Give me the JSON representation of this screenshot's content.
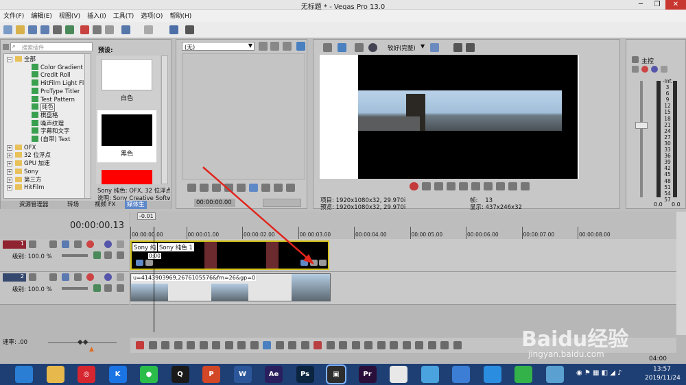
{
  "window": {
    "title": "无标题 * - Vegas Pro 13.0"
  },
  "menu": [
    "文件(F)",
    "编辑(E)",
    "视图(V)",
    "插入(I)",
    "工具(T)",
    "选项(O)",
    "帮助(H)"
  ],
  "explorer": {
    "search_placeholder": "搜索插件",
    "tree": [
      {
        "label": "全部",
        "kind": "folder",
        "expanded": true
      },
      {
        "label": "Color Gradient",
        "kind": "item"
      },
      {
        "label": "Credit Roll",
        "kind": "item"
      },
      {
        "label": "HitFilm Light Fla",
        "kind": "item"
      },
      {
        "label": "ProType Titler",
        "kind": "item"
      },
      {
        "label": "Test Pattern",
        "kind": "item"
      },
      {
        "label": "纯色",
        "kind": "item",
        "selected": true
      },
      {
        "label": "棋盘格",
        "kind": "item"
      },
      {
        "label": "噪声纹理",
        "kind": "item"
      },
      {
        "label": "字幕和文字",
        "kind": "item"
      },
      {
        "label": "(自带) Text",
        "kind": "item"
      },
      {
        "label": "OFX",
        "kind": "folder"
      },
      {
        "label": "32 位浮点",
        "kind": "folder"
      },
      {
        "label": "GPU 加速",
        "kind": "folder"
      },
      {
        "label": "Sony",
        "kind": "folder"
      },
      {
        "label": "第三方",
        "kind": "folder"
      },
      {
        "label": "HitFilm",
        "kind": "folder"
      }
    ],
    "presets_label": "预设:",
    "presets": [
      {
        "name": "白色",
        "color": "#ffffff"
      },
      {
        "name": "黑色",
        "color": "#000000"
      },
      {
        "name": "",
        "color": "#ff0000"
      }
    ],
    "info_line1": "Sony 纯色: OFX, 32 位浮点",
    "info_line2": "说明: Sony Creative Softw",
    "tabs": [
      "资源管理器",
      "转场",
      "视频 FX",
      "媒体生"
    ]
  },
  "trimmer": {
    "dropdown": "(无)",
    "time": "00:00:00.00"
  },
  "preview": {
    "quality": "较好(完整)",
    "project_label": "项目:",
    "project_value": "1920x1080x32, 29.970i",
    "preview_label": "预览:",
    "preview_value": "1920x1080x32, 29.970i",
    "frame_label": "帧:",
    "frame_value": "13",
    "display_label": "显示:",
    "display_value": "437x246x32"
  },
  "mixer": {
    "title": "主控",
    "scale": [
      "-Inf.",
      "3",
      "6",
      "9",
      "12",
      "15",
      "18",
      "21",
      "24",
      "27",
      "30",
      "33",
      "36",
      "39",
      "42",
      "45",
      "48",
      "51",
      "54",
      "57"
    ],
    "readout_left": "0.0",
    "readout_right": "0.0"
  },
  "timeline": {
    "timecode": "00:00:00.13",
    "cursor_label": "-0.01",
    "ruler_ticks": [
      "00:00:00.00",
      "00:00:01.00",
      "00:00:02.00",
      "00:00:03.00",
      "00:00:04.00",
      "00:00:05.00",
      "00:00:06.00",
      "00:00:07.00",
      "00:00:08.00"
    ],
    "tracks": [
      {
        "number": "1",
        "level_label": "级别: 100.0 %",
        "color": "#8f2330"
      },
      {
        "number": "2",
        "level_label": "级别: 100.0 %",
        "color": "#35486e"
      }
    ],
    "clip1_label_a": "Sony 纯",
    "clip1_label_b": "Sony 纯色 1",
    "clip1_time": "0:00",
    "clip2_label": "u=4143903969,2676105576&fm=26&gp=0",
    "rate_label": "速率: .00",
    "end_time": "04:00"
  },
  "watermark": {
    "brand": "Baidu经验",
    "url": "jingyan.baidu.com"
  },
  "taskbar": {
    "time": "13:57",
    "date": "2019/11/24",
    "apps": [
      {
        "name": "browser-app-icon",
        "color": "#2a7ed3",
        "text": ""
      },
      {
        "name": "file-explorer-icon",
        "color": "#e7b84b",
        "text": ""
      },
      {
        "name": "netease-music-icon",
        "color": "#d6262f",
        "text": "◎"
      },
      {
        "name": "kugou-icon",
        "color": "#1b74e4",
        "text": "K"
      },
      {
        "name": "wechat-icon",
        "color": "#2bbd4a",
        "text": "●"
      },
      {
        "name": "qq-icon",
        "color": "#1a1a1a",
        "text": "Q"
      },
      {
        "name": "powerpoint-icon",
        "color": "#d24726",
        "text": "P"
      },
      {
        "name": "word-icon",
        "color": "#2b579a",
        "text": "W"
      },
      {
        "name": "after-effects-icon",
        "color": "#2a1f5e",
        "text": "Ae"
      },
      {
        "name": "photoshop-icon",
        "color": "#0b2540",
        "text": "Ps"
      },
      {
        "name": "vegas-icon",
        "color": "#2d2d2d",
        "text": "▣"
      },
      {
        "name": "premiere-icon",
        "color": "#2a0f3a",
        "text": "Pr"
      },
      {
        "name": "color-app-icon",
        "color": "#e8e8e8",
        "text": ""
      },
      {
        "name": "chat-app-icon",
        "color": "#4aa3df",
        "text": ""
      },
      {
        "name": "mail-app-icon",
        "color": "#3c7ed6",
        "text": ""
      },
      {
        "name": "cloud-app-icon",
        "color": "#2b8de0",
        "text": ""
      },
      {
        "name": "upload-app-icon",
        "color": "#34b24a",
        "text": ""
      },
      {
        "name": "notes-app-icon",
        "color": "#5aa0d0",
        "text": ""
      }
    ]
  }
}
